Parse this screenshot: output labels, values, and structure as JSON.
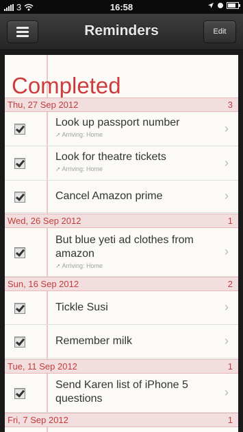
{
  "status_bar": {
    "carrier": "3",
    "time": "16:58"
  },
  "nav": {
    "title": "Reminders",
    "edit_label": "Edit"
  },
  "list": {
    "title": "Completed",
    "groups": [
      {
        "date": "Thu, 27 Sep 2012",
        "count": "3",
        "items": [
          {
            "text": "Look up passport number",
            "sub": "Arriving: Home",
            "checked": true
          },
          {
            "text": "Look for theatre tickets",
            "sub": "Arriving: Home",
            "checked": true
          },
          {
            "text": "Cancel Amazon prime",
            "checked": true
          }
        ]
      },
      {
        "date": "Wed, 26 Sep 2012",
        "count": "1",
        "items": [
          {
            "text_line1": "But blue yeti ad clothes from",
            "text_line2": "amazon",
            "sub": "Arriving: Home",
            "checked": true
          }
        ]
      },
      {
        "date": "Sun, 16 Sep 2012",
        "count": "2",
        "items": [
          {
            "text": "Tickle Susi",
            "checked": true
          },
          {
            "text": "Remember milk",
            "checked": true
          }
        ]
      },
      {
        "date": "Tue, 11 Sep 2012",
        "count": "1",
        "items": [
          {
            "text_line1": "Send Karen list of iPhone 5",
            "text_line2": "questions",
            "checked": true
          }
        ]
      },
      {
        "date": "Fri, 7 Sep 2012",
        "count": "1",
        "items": []
      }
    ]
  },
  "icons": {
    "menu": "hamburger-icon",
    "location": "location-arrow-icon",
    "chevron": "chevron-right-icon",
    "check": "checkbox-checked-icon"
  },
  "colors": {
    "accent": "#cc3c3c",
    "date_bg": "#f2dede",
    "paper": "#fbfaf7"
  }
}
